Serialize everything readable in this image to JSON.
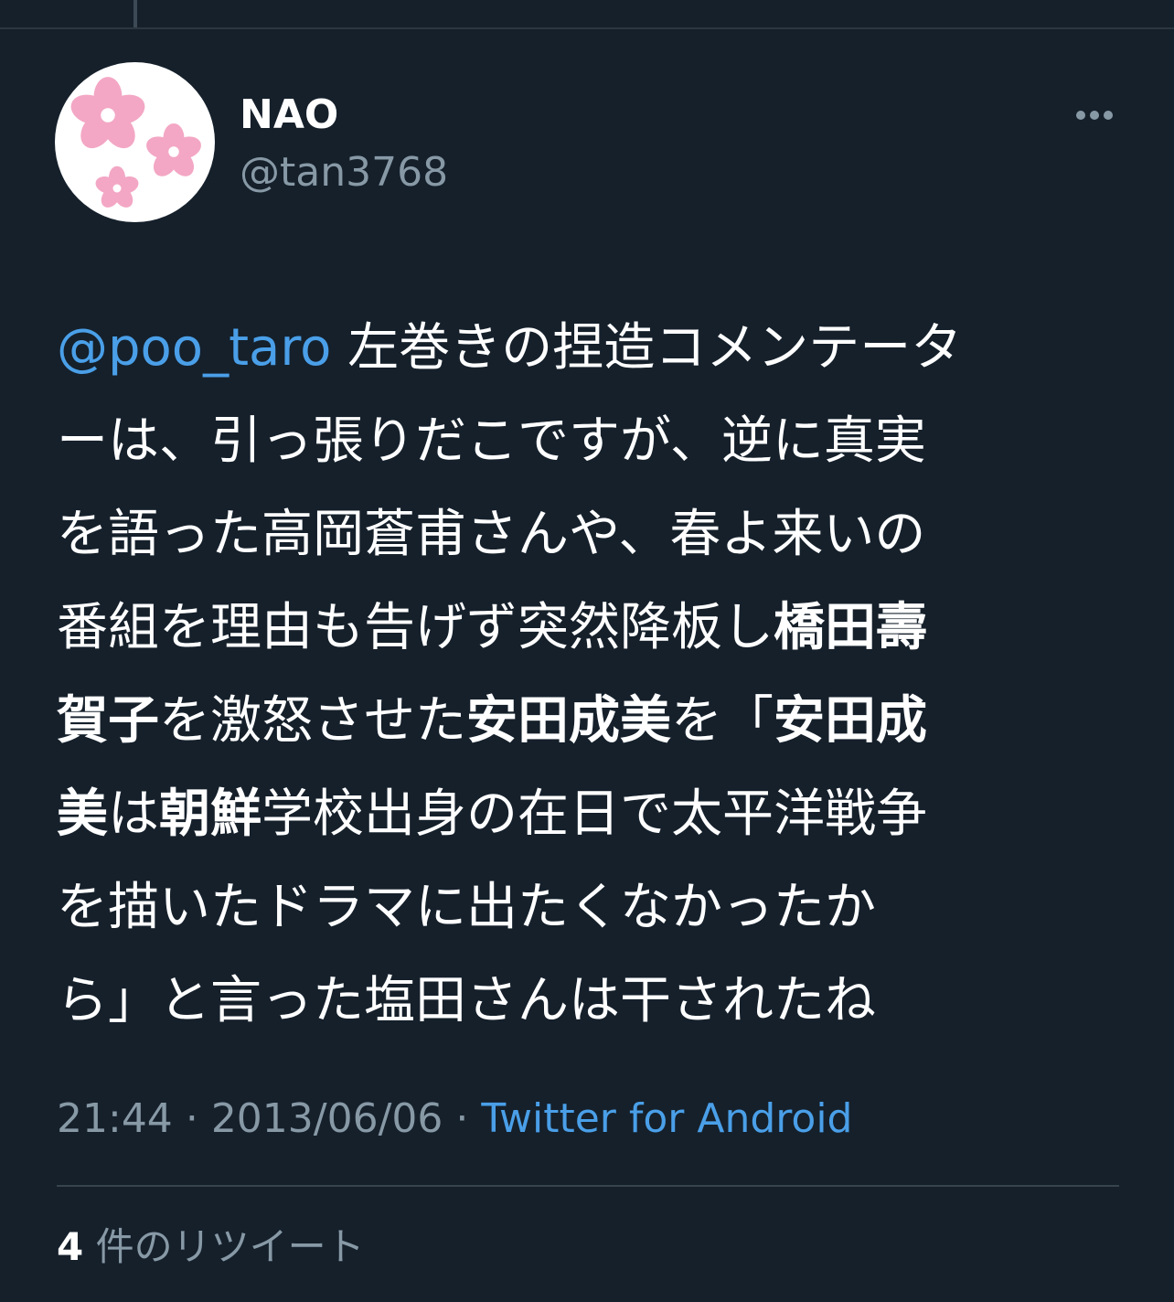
{
  "tweet": {
    "display_name": "NAO",
    "handle": "@tan3768",
    "avatar_icon": "cherry-blossom-avatar",
    "more_icon": "more-options-icon",
    "text_lines": [
      [
        {
          "t": "@poo_taro",
          "s": "mention"
        },
        {
          "t": " 左巻きの捏造コメンテータ",
          "s": "normal"
        }
      ],
      [
        {
          "t": "ーは、引っ張りだこですが、逆に真実",
          "s": "normal"
        }
      ],
      [
        {
          "t": "を語った高岡蒼甫さんや、春よ来いの",
          "s": "normal"
        }
      ],
      [
        {
          "t": "番組を理由も告げず突然降板し",
          "s": "normal"
        },
        {
          "t": "橋田壽",
          "s": "bold"
        }
      ],
      [
        {
          "t": "賀子",
          "s": "bold"
        },
        {
          "t": "を激怒させた",
          "s": "normal"
        },
        {
          "t": "安田成美",
          "s": "bold"
        },
        {
          "t": "を「",
          "s": "normal"
        },
        {
          "t": "安田成",
          "s": "bold"
        }
      ],
      [
        {
          "t": "美",
          "s": "bold"
        },
        {
          "t": "は",
          "s": "normal"
        },
        {
          "t": "朝鮮",
          "s": "bold"
        },
        {
          "t": "学校出身の在日で太平洋戦争",
          "s": "normal"
        }
      ],
      [
        {
          "t": "を描いたドラマに出たくなかったか",
          "s": "normal"
        }
      ],
      [
        {
          "t": "ら」と言った塩田さんは干されたね",
          "s": "normal"
        }
      ]
    ],
    "time": "21:44",
    "separator": "·",
    "date": "2013/06/06",
    "source": "Twitter for Android"
  },
  "stats": {
    "retweet_count": "4",
    "retweet_label": " 件のリツイート"
  },
  "colors": {
    "background": "#15202b",
    "link": "#4a9fe8",
    "muted": "#8899a6",
    "blossom": "#f3a7c4"
  }
}
